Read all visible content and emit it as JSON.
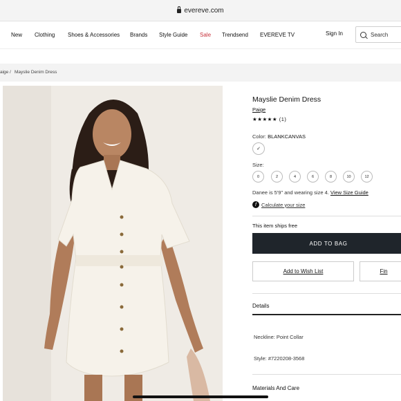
{
  "browser": {
    "url": "evereve.com"
  },
  "nav": {
    "items": [
      "New",
      "Clothing",
      "Shoes & Accessories",
      "Brands",
      "Style Guide",
      "Sale",
      "Trendsend",
      "EVEREVE TV"
    ],
    "sign_in": "Sign In",
    "search_placeholder": "Search"
  },
  "breadcrumb": {
    "items": [
      "aige",
      "Mayslie Denim Dress"
    ],
    "separator": "/"
  },
  "product": {
    "title": "Mayslie Denim Dress",
    "brand": "Paige",
    "stars": "★★★★★",
    "review_count": "(1)",
    "rating": 5,
    "color_label": "Color:",
    "color_value": "BLANKCANVAS",
    "size_label": "Size:",
    "sizes": [
      "0",
      "2",
      "4",
      "6",
      "8",
      "10",
      "12"
    ],
    "fit_note": "Danee is 5'9\" and wearing size 4.",
    "size_guide": "View Size Guide",
    "calculate": "Calculate your size",
    "ships": "This item ships free",
    "add_to_bag": "ADD TO BAG",
    "wish_list": "Add to Wish List",
    "find": "Fin",
    "details_heading": "Details",
    "neckline": "Neckline: Point Collar",
    "style": "Style: #7220208-3568",
    "materials_heading": "Materials And Care"
  },
  "colors": {
    "accent_dark": "#1f252b",
    "sale_red": "#c7323b"
  }
}
